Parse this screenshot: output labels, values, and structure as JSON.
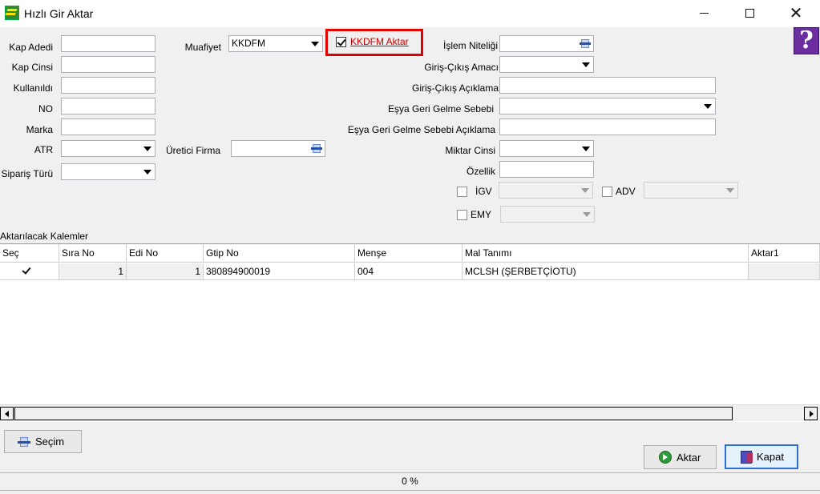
{
  "window": {
    "title": "Hızlı Gir Aktar"
  },
  "form": {
    "kap_adedi_label": "Kap Adedi",
    "kap_cinsi_label": "Kap Cinsi",
    "kullanildi_label": "Kullanıldı",
    "no_label": "NO",
    "marka_label": "Marka",
    "atr_label": "ATR",
    "siparis_turu_label": "Sipariş Türü",
    "muafiyet_label": "Muafiyet",
    "muafiyet_value": "KKDFM",
    "uretici_firma_label": "Üretici Firma",
    "kkdfm_aktar_label": "KKDFM Aktar",
    "islem_niteligi_label": "İşlem Niteliği",
    "giris_cikis_amaci_label": "Giriş-Çıkış Amacı",
    "giris_cikis_aciklama_label": "Giriş-Çıkış Açıklama",
    "esya_geri_gelme_sebebi_label": "Eşya Geri Gelme Sebebi",
    "esya_geri_gelme_sebebi_aciklama_label": "Eşya Geri Gelme Sebebi  Açıklama",
    "miktar_cinsi_label": "Miktar Cinsi",
    "ozellik_label": "Özellik",
    "igv_label": "İGV",
    "adv_label": "ADV",
    "emy_label": "EMY"
  },
  "grid": {
    "caption": "Aktarılacak Kalemler",
    "columns": [
      "Seç",
      "Sıra No",
      "Edi No",
      "Gtip No",
      "Menşe",
      "Mal Tanımı",
      "Aktar1"
    ],
    "rows": [
      {
        "secili": true,
        "sira_no": "1",
        "edi_no": "1",
        "gtip_no": "380894900019",
        "mense": "004",
        "mal_tanimi": "MCLSH (ŞERBETÇİOTU)",
        "aktar1": ""
      }
    ]
  },
  "buttons": {
    "secim": "Seçim",
    "aktar": "Aktar",
    "kapat": "Kapat"
  },
  "status": {
    "progress": "0 %"
  },
  "colors": {
    "highlight": "#e00000",
    "help_bg": "#6b2da0",
    "focus": "#2b6fd6"
  },
  "icons": {
    "help": "?",
    "close": "✕"
  }
}
